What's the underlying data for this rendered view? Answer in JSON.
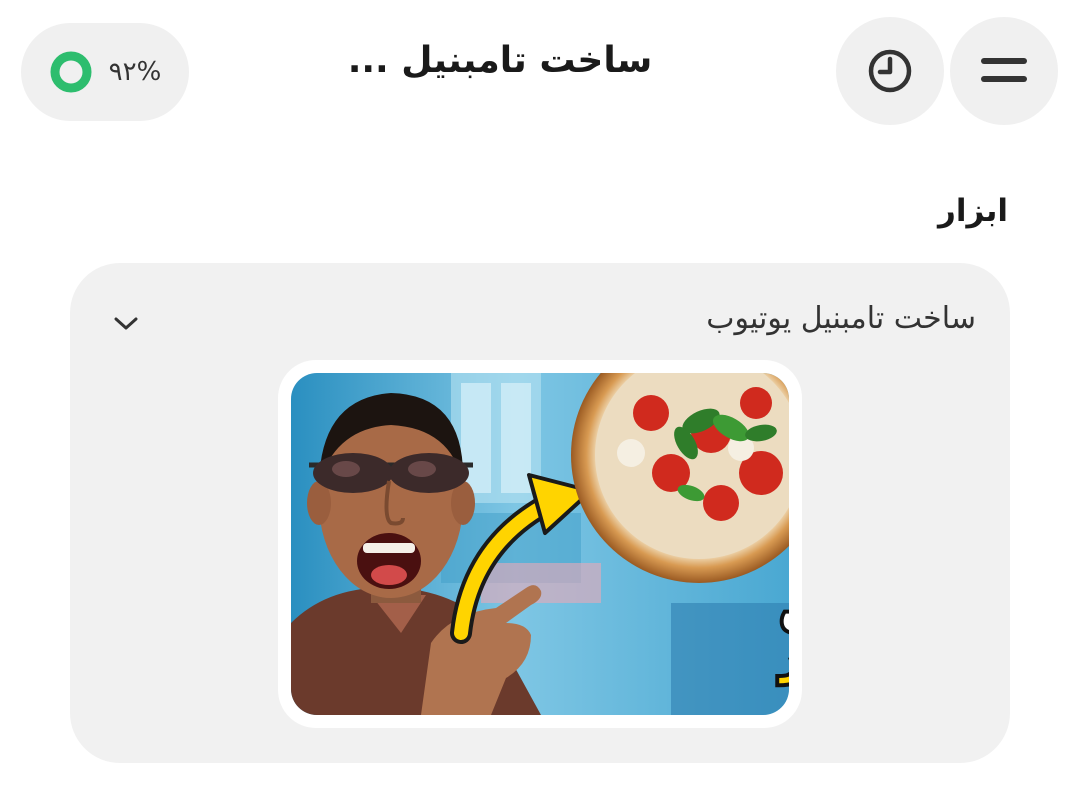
{
  "header": {
    "title": "ساخت تامبنیل ...",
    "menu_icon": "hamburger-menu-icon",
    "history_icon": "clock-history-icon",
    "credit_percent": "۹۲%",
    "credit_ring_color": "#2dbd6e"
  },
  "section": {
    "title": "ابزار"
  },
  "tool": {
    "name": "ساخت تامبنیل یوتیوب",
    "expand_icon": "chevron-down-icon",
    "thumbnail": {
      "line1": "پیتزا ناپولش",
      "line2": "ناپولیتن بپز",
      "accent_color": "#ffd400"
    }
  }
}
